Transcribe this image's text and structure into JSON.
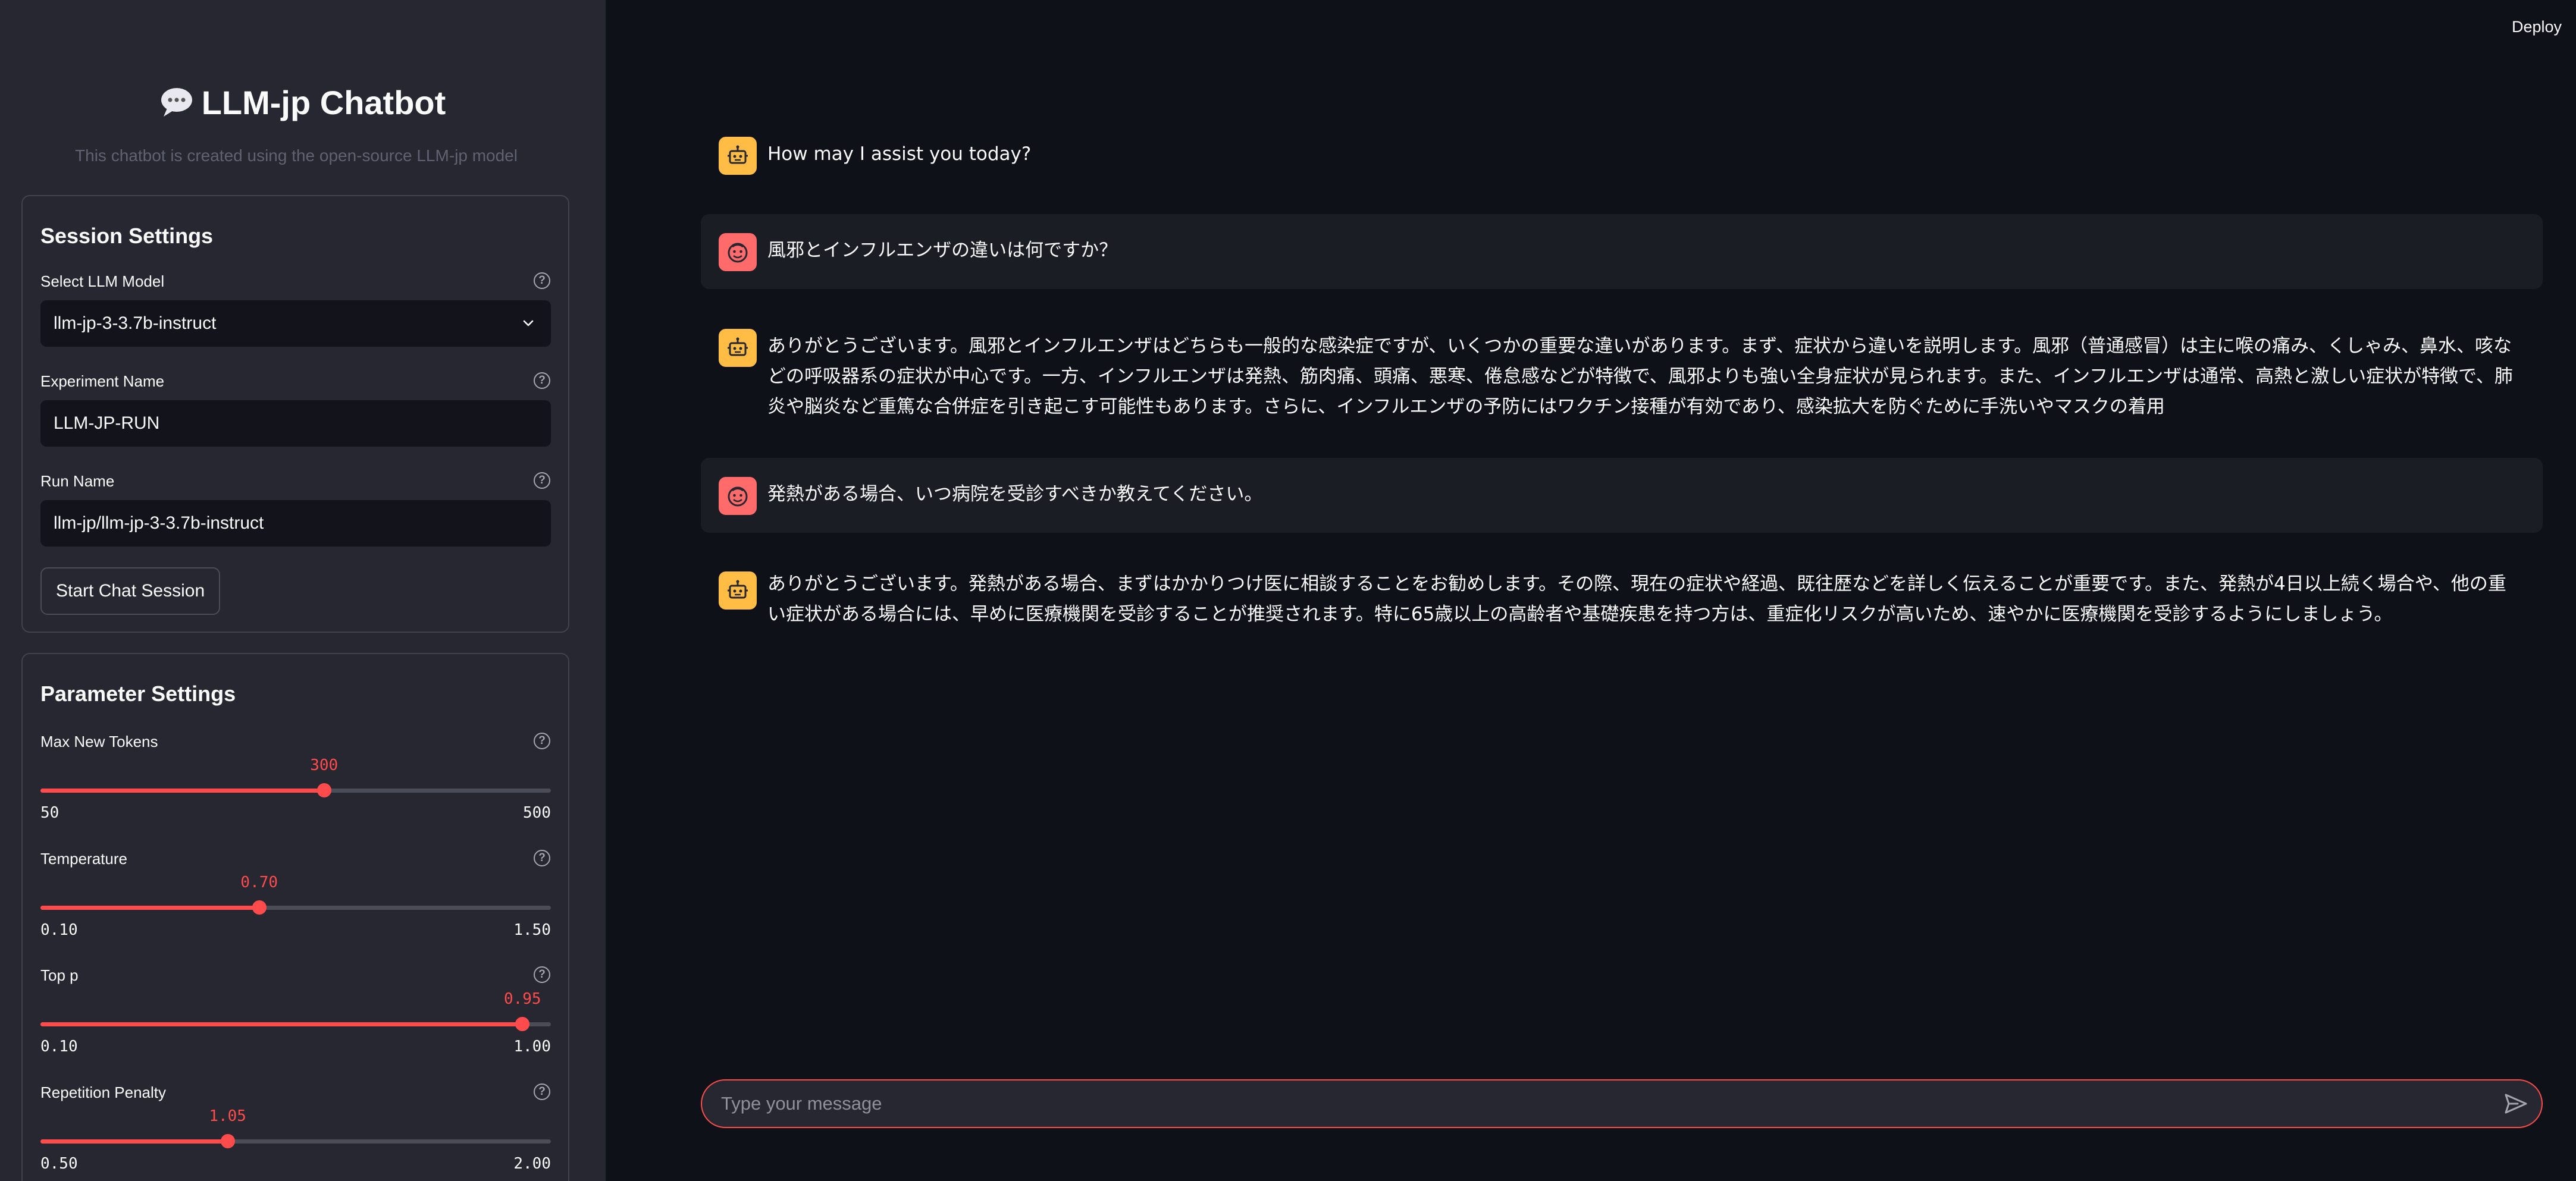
{
  "app": {
    "title": "LLM-jp Chatbot",
    "caption": "This chatbot is created using the open-source LLM-jp model",
    "deploy_label": "Deploy"
  },
  "session": {
    "heading": "Session Settings",
    "model_label": "Select LLM Model",
    "model_value": "llm-jp-3-3.7b-instruct",
    "experiment_label": "Experiment Name",
    "experiment_value": "LLM-JP-RUN",
    "run_label": "Run Name",
    "run_value": "llm-jp/llm-jp-3-3.7b-instruct",
    "start_button": "Start Chat Session"
  },
  "params": {
    "heading": "Parameter Settings",
    "sliders": [
      {
        "label": "Max New Tokens",
        "value": "300",
        "min": "50",
        "max": "500",
        "fraction": 0.5556
      },
      {
        "label": "Temperature",
        "value": "0.70",
        "min": "0.10",
        "max": "1.50",
        "fraction": 0.4286
      },
      {
        "label": "Top p",
        "value": "0.95",
        "min": "0.10",
        "max": "1.00",
        "fraction": 0.9444
      },
      {
        "label": "Repetition Penalty",
        "value": "1.05",
        "min": "0.50",
        "max": "2.00",
        "fraction": 0.3667
      }
    ]
  },
  "messages": [
    {
      "role": "assistant",
      "text": "How may I assist you today?"
    },
    {
      "role": "user",
      "text": "風邪とインフルエンザの違いは何ですか？"
    },
    {
      "role": "assistant",
      "text": "ありがとうございます。風邪とインフルエンザはどちらも一般的な感染症ですが、いくつかの重要な違いがあります。まず、症状から違いを説明します。風邪（普通感冒）は主に喉の痛み、くしゃみ、鼻水、咳などの呼吸器系の症状が中心です。一方、インフルエンザは発熱、筋肉痛、頭痛、悪寒、倦怠感などが特徴で、風邪よりも強い全身症状が見られます。また、インフルエンザは通常、高熱と激しい症状が特徴で、肺炎や脳炎など重篤な合併症を引き起こす可能性もあります。さらに、インフルエンザの予防にはワクチン接種が有効であり、感染拡大を防ぐために手洗いやマスクの着用"
    },
    {
      "role": "user",
      "text": "発熱がある場合、いつ病院を受診すべきか教えてください。"
    },
    {
      "role": "assistant",
      "text": "ありがとうございます。発熱がある場合、まずはかかりつけ医に相談することをお勧めします。その際、現在の症状や経過、既往歴などを詳しく伝えることが重要です。また、発熱が4日以上続く場合や、他の重い症状がある場合には、早めに医療機関を受診することが推奨されます。特に65歳以上の高齢者や基礎疾患を持つ方は、重症化リスクが高いため、速やかに医療機関を受診するようにしましょう。"
    }
  ],
  "chat_input": {
    "placeholder": "Type your message"
  },
  "icons": [
    "speech-bubble-icon",
    "help-icon",
    "chevron-down-icon",
    "robot-icon",
    "smiley-face-icon",
    "send-icon"
  ],
  "colors": {
    "accent": "#ff4b4b",
    "sidebar_bg": "#262730",
    "main_bg": "#0e1117",
    "bot_avatar": "#ffbd45",
    "user_avatar": "#ff6b6b"
  }
}
